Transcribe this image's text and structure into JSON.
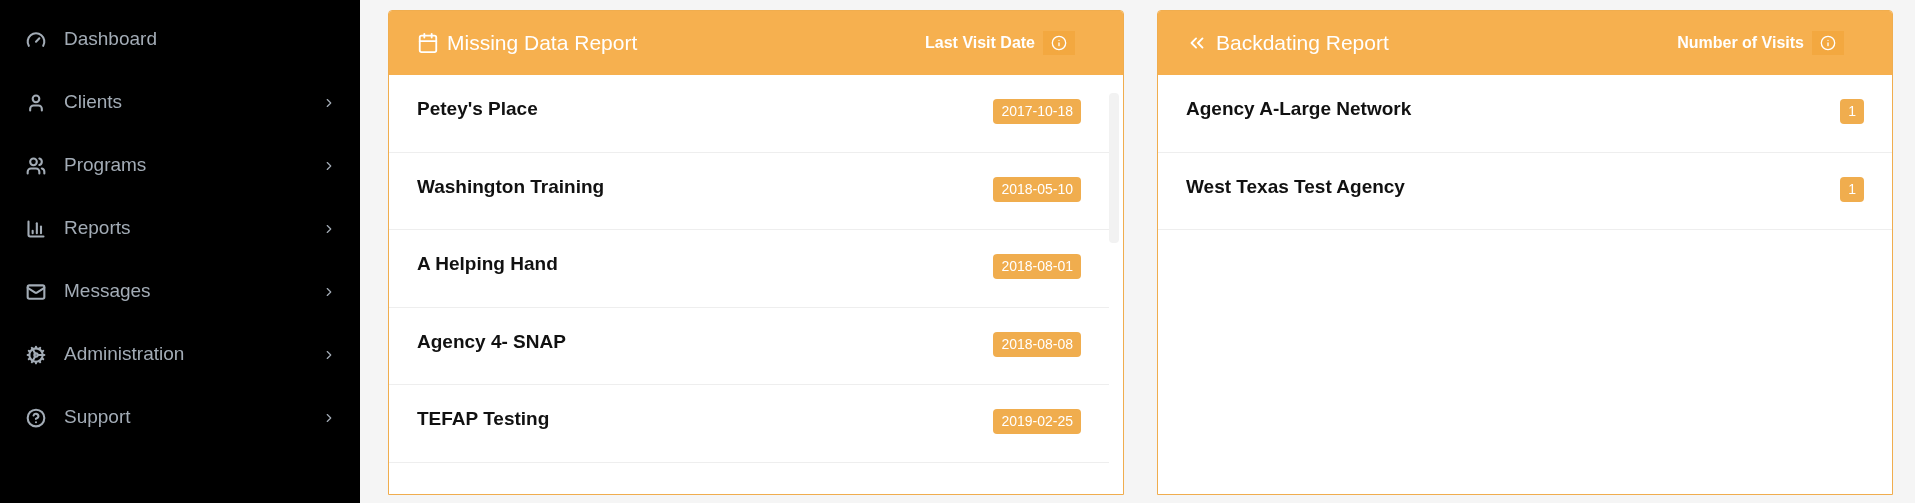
{
  "sidebar": {
    "items": [
      {
        "label": "Dashboard",
        "has_submenu": false
      },
      {
        "label": "Clients",
        "has_submenu": true
      },
      {
        "label": "Programs",
        "has_submenu": true
      },
      {
        "label": "Reports",
        "has_submenu": true
      },
      {
        "label": "Messages",
        "has_submenu": true
      },
      {
        "label": "Administration",
        "has_submenu": true
      },
      {
        "label": "Support",
        "has_submenu": true
      }
    ]
  },
  "panels": [
    {
      "title": "Missing Data Report",
      "column_label": "Last Visit Date",
      "scrollable": true,
      "rows": [
        {
          "name": "Petey's Place",
          "value": "2017-10-18"
        },
        {
          "name": "Washington Training",
          "value": "2018-05-10"
        },
        {
          "name": "A Helping Hand",
          "value": "2018-08-01"
        },
        {
          "name": "Agency 4- SNAP",
          "value": "2018-08-08"
        },
        {
          "name": "TEFAP Testing",
          "value": "2019-02-25"
        }
      ]
    },
    {
      "title": "Backdating Report",
      "column_label": "Number of Visits",
      "scrollable": false,
      "rows": [
        {
          "name": "Agency A-Large Network",
          "value": "1"
        },
        {
          "name": "West Texas Test Agency",
          "value": "1"
        }
      ]
    }
  ]
}
